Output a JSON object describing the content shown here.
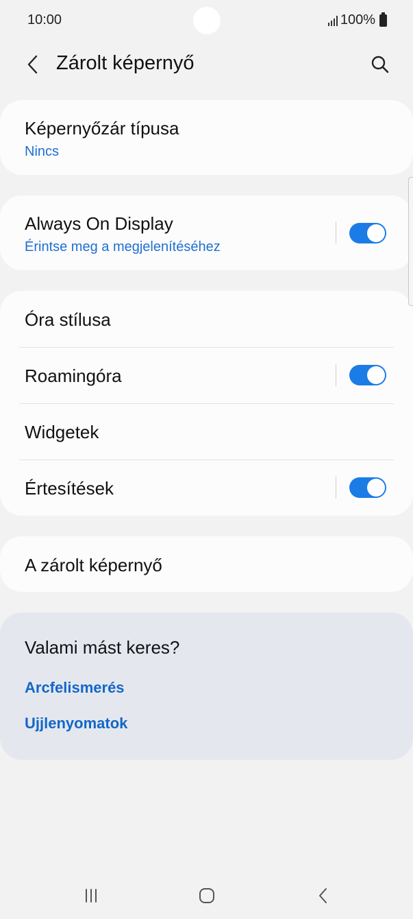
{
  "status_bar": {
    "time": "10:00",
    "battery": "100%",
    "icons": [
      "signal-icon",
      "battery-icon"
    ]
  },
  "header": {
    "title": "Zárolt képernyő",
    "back_icon": "chevron-left-icon",
    "search_icon": "search-icon"
  },
  "lock_type": {
    "title": "Képernyőzár típusa",
    "value": "Nincs"
  },
  "aod": {
    "title": "Always On Display",
    "subtitle": "Érintse meg a megjelenítéséhez",
    "enabled": true
  },
  "settings": {
    "clock_style": "Óra stílusa",
    "roaming_clock": "Roamingóra",
    "roaming_clock_enabled": true,
    "widgets": "Widgetek",
    "notifications": "Értesítések",
    "notifications_enabled": true
  },
  "about": {
    "title": "A zárolt képernyő"
  },
  "suggestions": {
    "title": "Valami mást keres?",
    "links": [
      "Arcfelismerés",
      "Ujjlenyomatok"
    ]
  },
  "nav": {
    "icons": [
      "recent-apps-icon",
      "home-icon",
      "back-icon"
    ]
  },
  "colors": {
    "accent": "#1c7ce6",
    "link": "#1466c8",
    "background": "#f2f2f2",
    "card": "#fcfcfc",
    "suggest_card": "#e4e8ee"
  }
}
